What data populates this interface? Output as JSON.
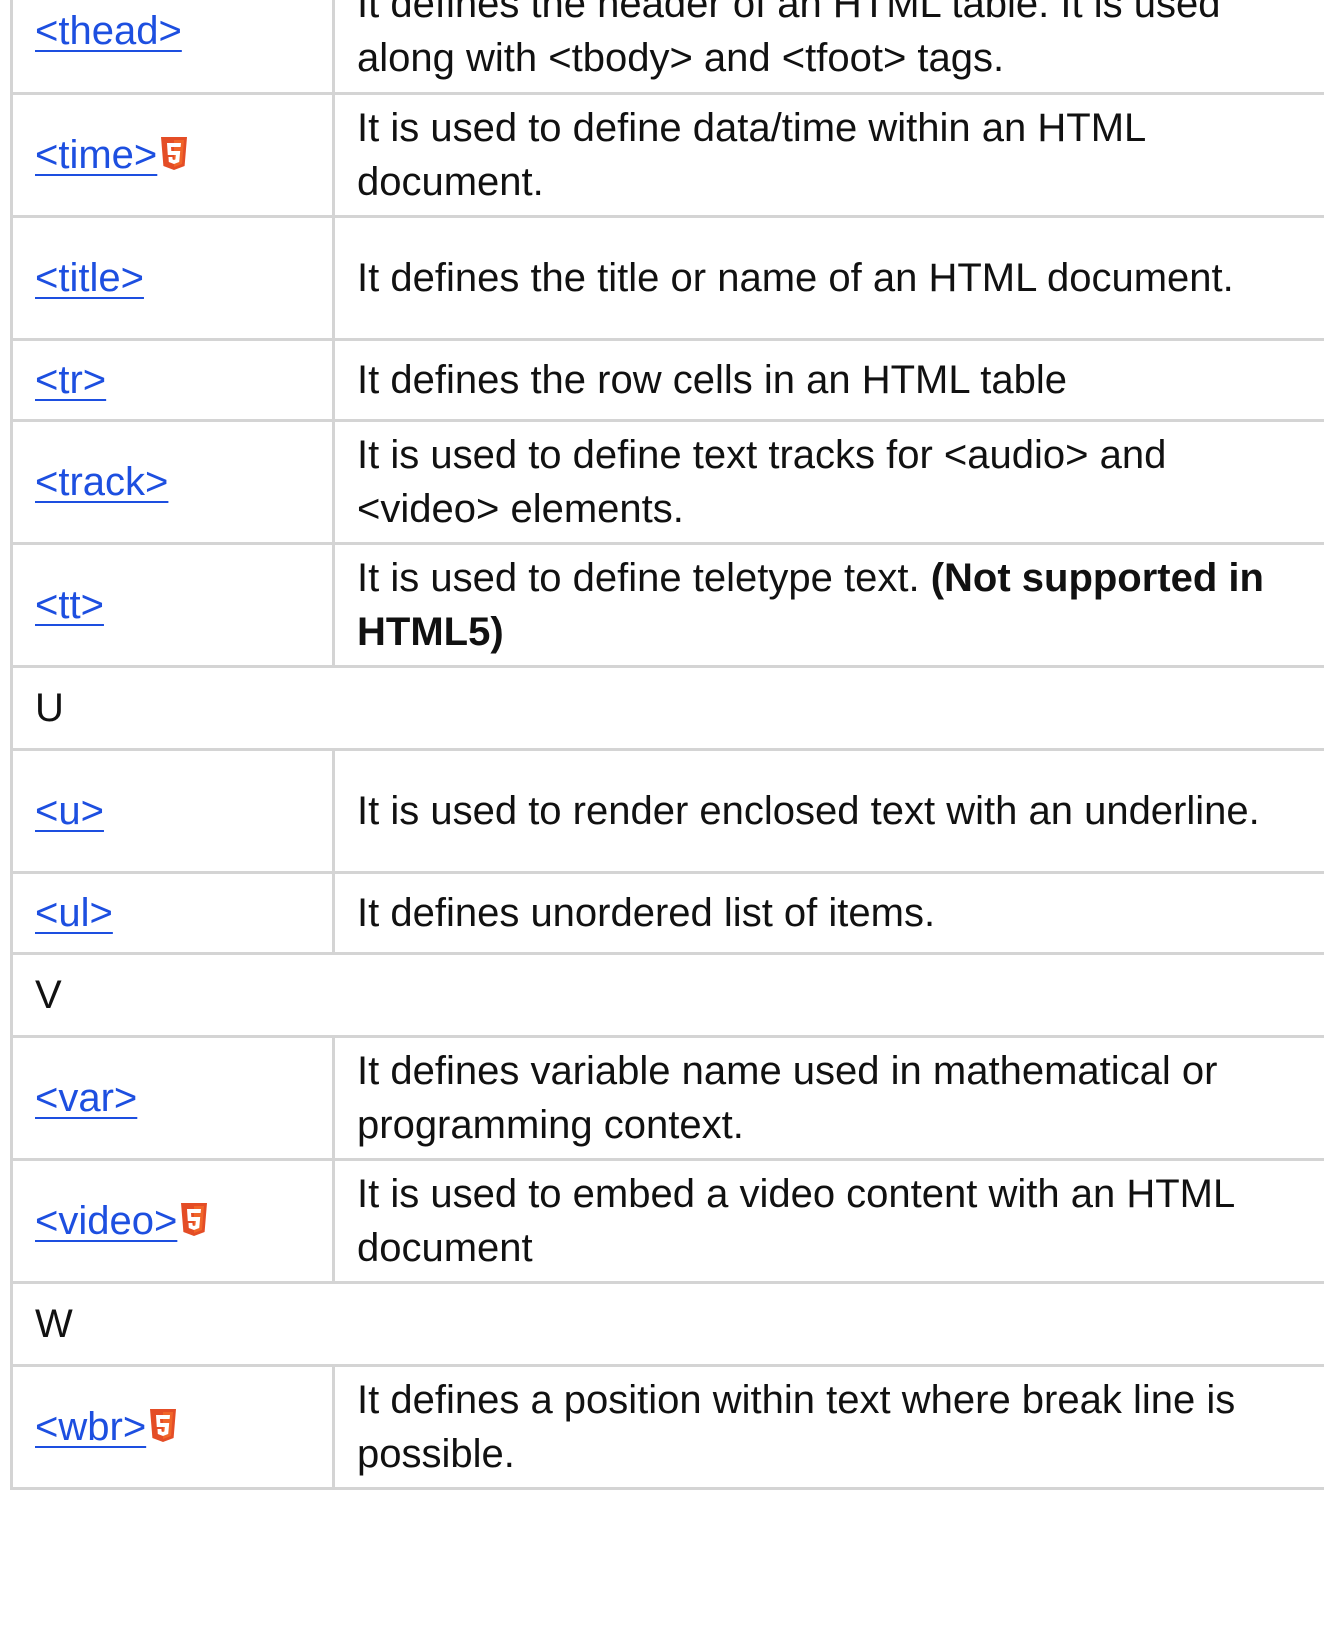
{
  "rows": [
    {
      "kind": "tag",
      "tag": "<thead>",
      "html5": false,
      "desc": "It defines the header of an HTML table. It is used along with <tbody> and <tfoot> tags.",
      "note": ""
    },
    {
      "kind": "tag",
      "tag": "<time>",
      "html5": true,
      "desc": "It is used to define data/time within an HTML document.",
      "note": ""
    },
    {
      "kind": "tag",
      "tag": "<title>",
      "html5": false,
      "desc": "It defines the title or name of an HTML document.",
      "note": ""
    },
    {
      "kind": "tag",
      "tag": "<tr>",
      "html5": false,
      "desc": "It defines the row cells in an HTML table",
      "note": ""
    },
    {
      "kind": "tag",
      "tag": "<track>",
      "html5": false,
      "desc": "It is used to define text tracks for <audio> and <video> elements.",
      "note": ""
    },
    {
      "kind": "tag",
      "tag": "<tt>",
      "html5": false,
      "desc": "It is used to define teletype text.",
      "note": "(Not supported in HTML5)"
    },
    {
      "kind": "letter",
      "letter": "U"
    },
    {
      "kind": "tag",
      "tag": "<u>",
      "html5": false,
      "desc": "It is used to render enclosed text with an underline.",
      "note": ""
    },
    {
      "kind": "tag",
      "tag": "<ul>",
      "html5": false,
      "desc": "It defines unordered list of items.",
      "note": ""
    },
    {
      "kind": "letter",
      "letter": "V"
    },
    {
      "kind": "tag",
      "tag": "<var>",
      "html5": false,
      "desc": "It defines variable name used in mathematical or programming context.",
      "note": ""
    },
    {
      "kind": "tag",
      "tag": "<video>",
      "html5": true,
      "desc": "It is used to embed a video content with an HTML document",
      "note": ""
    },
    {
      "kind": "letter",
      "letter": "W"
    },
    {
      "kind": "tag",
      "tag": "<wbr>",
      "html5": true,
      "desc": "It defines a position within text where break line is possible.",
      "note": ""
    }
  ],
  "colors": {
    "link": "#1d4fe0",
    "border": "#d4d4d4",
    "html5_badge": "#e44d26",
    "html5_badge_light": "#f16529"
  },
  "icons": {
    "html5": "html5-badge-icon"
  }
}
